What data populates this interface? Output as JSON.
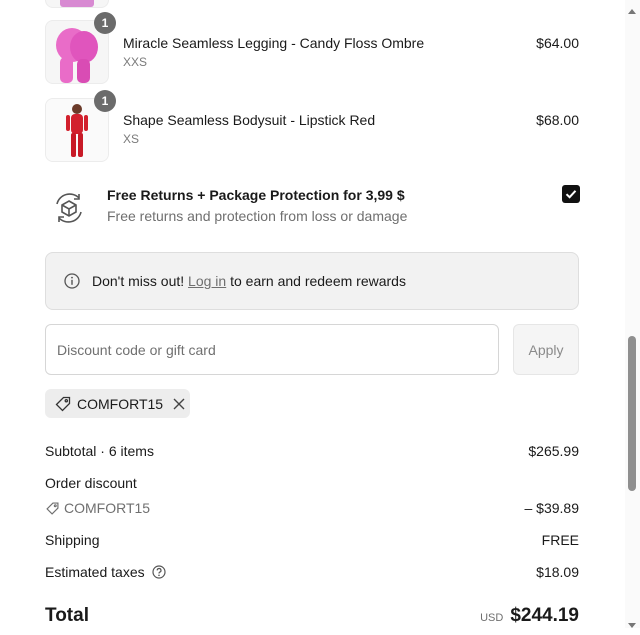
{
  "items": [
    {
      "name": "Miracle Seamless Legging - Candy Floss Ombre",
      "variant": "XXS",
      "price": "$64.00",
      "qty": "1"
    },
    {
      "name": "Shape Seamless Bodysuit - Lipstick Red",
      "variant": "XS",
      "price": "$68.00",
      "qty": "1"
    }
  ],
  "protection": {
    "title": "Free Returns + Package Protection for 3,99 $",
    "subtitle": "Free returns and protection from loss or damage",
    "checked": true
  },
  "rewards_notice": {
    "prefix": "Don't miss out!",
    "link": "Log in",
    "suffix": "to earn and redeem rewards"
  },
  "discount": {
    "placeholder": "Discount code or gift card",
    "apply_label": "Apply",
    "applied_code": "COMFORT15"
  },
  "summary": {
    "subtotal_label": "Subtotal · 6 items",
    "subtotal_value": "$265.99",
    "order_discount_label": "Order discount",
    "discount_code": "COMFORT15",
    "discount_value": "– $39.89",
    "shipping_label": "Shipping",
    "shipping_value": "FREE",
    "taxes_label": "Estimated taxes",
    "taxes_value": "$18.09",
    "total_label": "Total",
    "total_currency": "USD",
    "total_value": "$244.19"
  },
  "colors": {
    "legging": "#e45fc0",
    "bodysuit": "#d2202d",
    "scrollbar": "#8f8f8f"
  }
}
